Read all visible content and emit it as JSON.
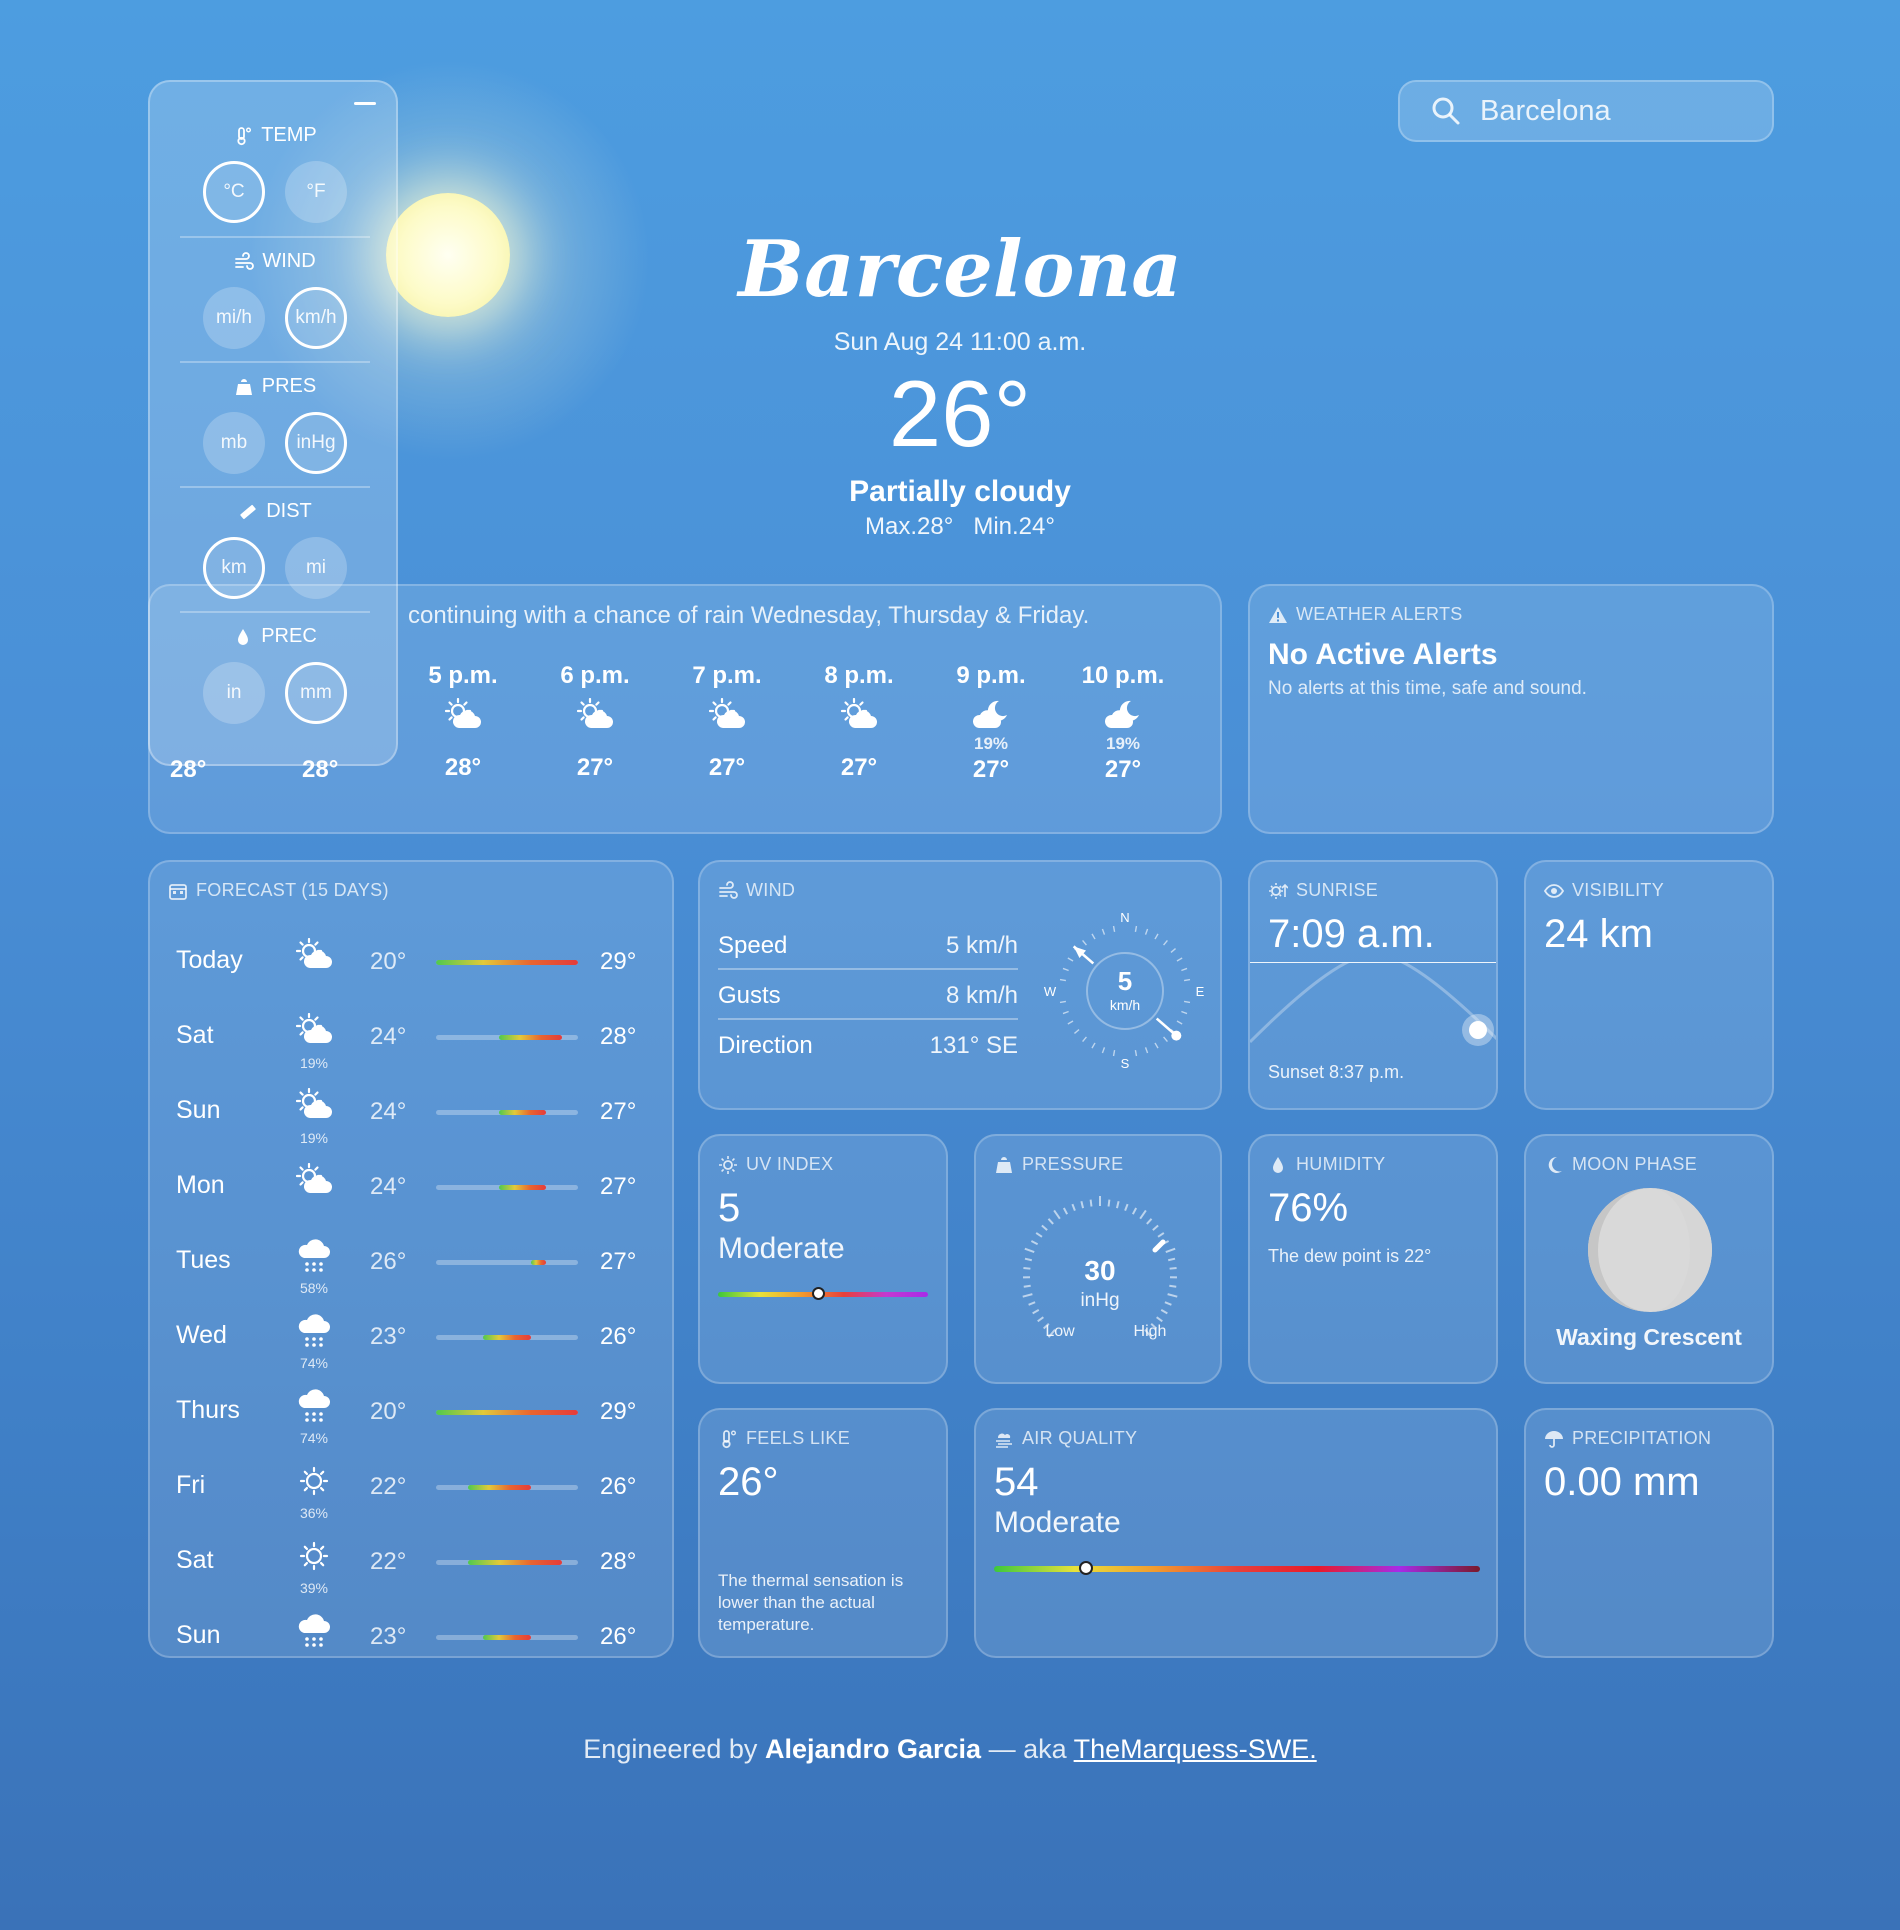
{
  "search": {
    "placeholder": "Barcelona"
  },
  "hero": {
    "city": "Barcelona",
    "datetime": "Sun Aug 24 11:00 a.m.",
    "temp": "26°",
    "condition": "Partially cloudy",
    "max": "Max.28°",
    "min": "Min.24°"
  },
  "settings": {
    "temp": {
      "title": "TEMP",
      "options": [
        "°C",
        "°F"
      ],
      "selected": "°C"
    },
    "wind": {
      "title": "WIND",
      "options": [
        "mi/h",
        "km/h"
      ],
      "selected": "km/h"
    },
    "pres": {
      "title": "PRES",
      "options": [
        "mb",
        "inHg"
      ],
      "selected": "inHg"
    },
    "dist": {
      "title": "DIST",
      "options": [
        "km",
        "mi"
      ],
      "selected": "km"
    },
    "prec": {
      "title": "PREC",
      "options": [
        "in",
        "mm"
      ],
      "selected": "mm"
    }
  },
  "hourly": {
    "summary": "continuing with a chance of rain Wednesday, Thursday & Friday.",
    "hidden_temps": [
      "28°",
      "28°"
    ],
    "hours": [
      {
        "time": "5 p.m.",
        "icon": "partly-cloudy-day-icon",
        "pop": "",
        "temp": "28°"
      },
      {
        "time": "6 p.m.",
        "icon": "partly-cloudy-day-icon",
        "pop": "",
        "temp": "27°"
      },
      {
        "time": "7 p.m.",
        "icon": "partly-cloudy-day-icon",
        "pop": "",
        "temp": "27°"
      },
      {
        "time": "8 p.m.",
        "icon": "partly-cloudy-day-icon",
        "pop": "",
        "temp": "27°"
      },
      {
        "time": "9 p.m.",
        "icon": "partly-cloudy-night-icon",
        "pop": "19%",
        "temp": "27°"
      },
      {
        "time": "10 p.m.",
        "icon": "partly-cloudy-night-icon",
        "pop": "19%",
        "temp": "27°"
      }
    ]
  },
  "alerts": {
    "label": "WEATHER ALERTS",
    "title": "No Active Alerts",
    "message": "No alerts at this time, safe and sound."
  },
  "forecast": {
    "label": "FORECAST (15 DAYS)",
    "range_min": 20,
    "range_max": 29,
    "days": [
      {
        "day": "Today",
        "icon": "partly-cloudy-day-icon",
        "pop": "",
        "min": "20°",
        "max": "29°",
        "lo": 20,
        "hi": 29
      },
      {
        "day": "Sat",
        "icon": "partly-cloudy-day-icon",
        "pop": "19%",
        "min": "24°",
        "max": "28°",
        "lo": 24,
        "hi": 28
      },
      {
        "day": "Sun",
        "icon": "partly-cloudy-day-icon",
        "pop": "19%",
        "min": "24°",
        "max": "27°",
        "lo": 24,
        "hi": 27
      },
      {
        "day": "Mon",
        "icon": "partly-cloudy-day-icon",
        "pop": "",
        "min": "24°",
        "max": "27°",
        "lo": 24,
        "hi": 27
      },
      {
        "day": "Tues",
        "icon": "rain-icon",
        "pop": "58%",
        "min": "26°",
        "max": "27°",
        "lo": 26,
        "hi": 27
      },
      {
        "day": "Wed",
        "icon": "rain-icon",
        "pop": "74%",
        "min": "23°",
        "max": "26°",
        "lo": 23,
        "hi": 26
      },
      {
        "day": "Thurs",
        "icon": "rain-icon",
        "pop": "74%",
        "min": "20°",
        "max": "29°",
        "lo": 20,
        "hi": 29
      },
      {
        "day": "Fri",
        "icon": "sun-icon",
        "pop": "36%",
        "min": "22°",
        "max": "26°",
        "lo": 22,
        "hi": 26
      },
      {
        "day": "Sat",
        "icon": "sun-icon",
        "pop": "39%",
        "min": "22°",
        "max": "28°",
        "lo": 22,
        "hi": 28
      },
      {
        "day": "Sun",
        "icon": "rain-icon",
        "pop": "",
        "min": "23°",
        "max": "26°",
        "lo": 23,
        "hi": 26
      }
    ]
  },
  "wind": {
    "label": "WIND",
    "speed_label": "Speed",
    "speed": "5 km/h",
    "gusts_label": "Gusts",
    "gusts": "8 km/h",
    "direction_label": "Direction",
    "direction": "131° SE",
    "compass_value": "5",
    "compass_unit": "km/h",
    "direction_deg": 131,
    "n": "N",
    "e": "E",
    "s": "S",
    "w": "W"
  },
  "sunrise": {
    "label": "SUNRISE",
    "value": "7:09 a.m.",
    "sunset": "Sunset 8:37 p.m."
  },
  "visibility": {
    "label": "VISIBILITY",
    "value": "24 km"
  },
  "uv": {
    "label": "UV INDEX",
    "value": "5",
    "level": "Moderate",
    "fraction": 0.48
  },
  "pressure": {
    "label": "PRESSURE",
    "value": "30",
    "unit": "inHg",
    "low": "Low",
    "high": "High"
  },
  "humidity": {
    "label": "HUMIDITY",
    "value": "76%",
    "note": "The dew point is 22°"
  },
  "moon": {
    "label": "MOON PHASE",
    "phase": "Waxing Crescent"
  },
  "feels": {
    "label": "FEELS LIKE",
    "value": "26°",
    "note": "The thermal sensation is lower than the actual temperature."
  },
  "air": {
    "label": "AIR QUALITY",
    "value": "54",
    "level": "Moderate",
    "fraction": 0.19
  },
  "precip": {
    "label": "PRECIPITATION",
    "value": "0.00 mm"
  },
  "footer": {
    "prefix": "Engineered by",
    "author": "Alejandro Garcia",
    "mid": "— aka",
    "handle": "TheMarquess-SWE."
  }
}
